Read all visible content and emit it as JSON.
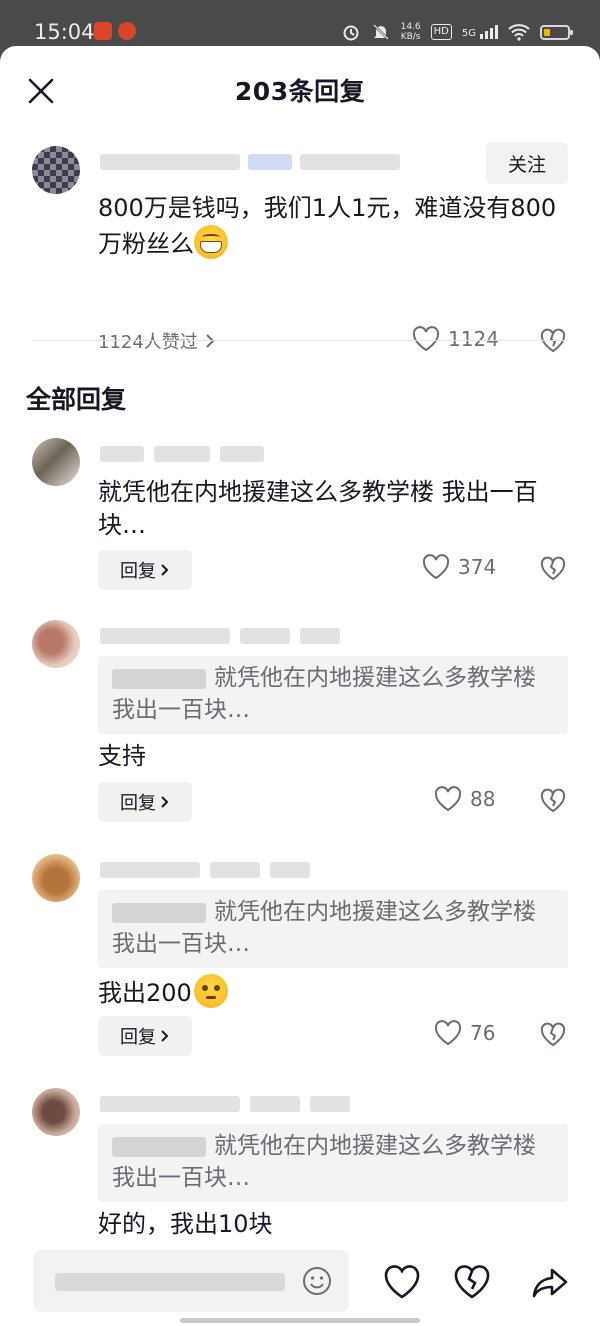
{
  "status_bar": {
    "time": "15:04",
    "net_speed_top": "14.6",
    "net_speed_unit": "KB/s",
    "hd_badge": "HD",
    "signal_label": "5G"
  },
  "header": {
    "title": "203条回复"
  },
  "top_comment": {
    "follow_label": "关注",
    "text": "800万是钱吗，我们1人1元，难道没有800万粉丝么",
    "likers_text": "1124人赞过",
    "like_count": "1124"
  },
  "section": {
    "title": "全部回复"
  },
  "replies": [
    {
      "text": "就凭他在内地援建这么多教学楼 我出一百块…",
      "quote_text": "",
      "reply_label": "回复",
      "like_count": "374"
    },
    {
      "quote_text": "就凭他在内地援建这么多教学楼 我出一百块…",
      "text": "支持",
      "reply_label": "回复",
      "like_count": "88"
    },
    {
      "quote_text": "就凭他在内地援建这么多教学楼 我出一百块…",
      "text": "我出200",
      "reply_label": "回复",
      "like_count": "76"
    },
    {
      "quote_text": "就凭他在内地援建这么多教学楼 我出一百块…",
      "text": "好的，我出10块"
    }
  ],
  "colors": {
    "accent_text": "#161823",
    "secondary_text": "#6b6d75",
    "battery": "#f5b400"
  }
}
